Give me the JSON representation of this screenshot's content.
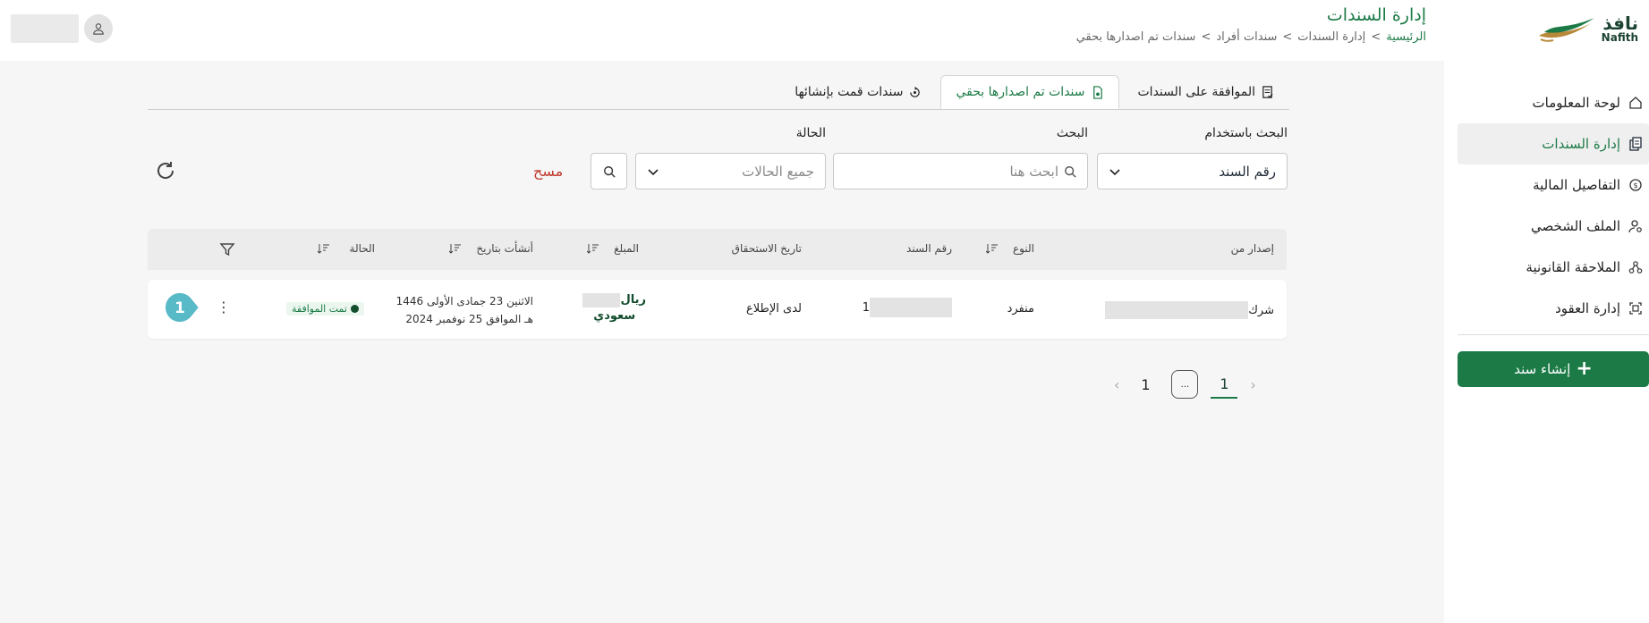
{
  "brand": {
    "name_ar": "نافذ",
    "name_en": "Nafith"
  },
  "sidebar": {
    "items": [
      {
        "label": "لوحة المعلومات",
        "icon": "home-icon"
      },
      {
        "label": "إدارة السندات",
        "icon": "documents-icon",
        "active": true
      },
      {
        "label": "التفاصيل المالية",
        "icon": "money-icon"
      },
      {
        "label": "الملف الشخصي",
        "icon": "user-settings-icon"
      },
      {
        "label": "الملاحقة القانونية",
        "icon": "legal-icon"
      },
      {
        "label": "إدارة العقود",
        "icon": "contract-icon"
      }
    ],
    "create_button": "إنشاء سند"
  },
  "header": {
    "title": "إدارة السندات",
    "breadcrumb": [
      "الرئيسية",
      "إدارة السندات",
      "سندات أفراد",
      "سندات تم اصدارها بحقي"
    ],
    "breadcrumb_separator": ">"
  },
  "tabs": [
    {
      "label": "الموافقة على السندات",
      "icon": "approval-icon"
    },
    {
      "label": "سندات تم اصدارها بحقي",
      "icon": "document-issued-icon",
      "active": true
    },
    {
      "label": "سندات قمت بإنشائها",
      "icon": "document-created-icon"
    }
  ],
  "filters": {
    "search_by_label": "البحث باستخدام",
    "search_by_value": "رقم السند",
    "search_label": "البحث",
    "search_placeholder": "ابحث هنا",
    "status_label": "الحالة",
    "status_value": "جميع الحالات",
    "clear": "مسح"
  },
  "table": {
    "headers": [
      "إصدار من",
      "النوع",
      "رقم السند",
      "تاريخ الاستحقاق",
      "المبلغ",
      "أنشأت بتاريخ",
      "الحالة"
    ],
    "rows": [
      {
        "issuer": "شرك",
        "type": "منفرد",
        "number": "1",
        "due": "لدى الإطلاع",
        "amount_line1": "ريال",
        "amount_line2": "سعودي",
        "created_line1": "الاثنين 23 جمادى الأولى 1446",
        "created_line2": "هـ الموافق 25 نوفمبر 2024",
        "status": "تمت الموافقة"
      }
    ]
  },
  "step_marker": "1",
  "pagination": {
    "pages": [
      "1",
      "...",
      "1"
    ]
  },
  "colors": {
    "primary": "#1b7a46",
    "danger": "#c0392b",
    "dark_green": "#124d2d"
  }
}
